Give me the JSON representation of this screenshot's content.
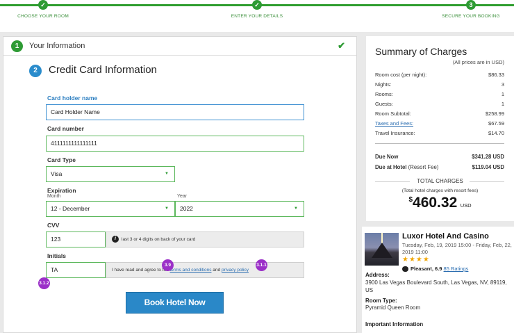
{
  "progress": {
    "steps": [
      {
        "number": "",
        "label": "CHOOSE YOUR ROOM"
      },
      {
        "number": "",
        "label": "ENTER YOUR DETAILS"
      },
      {
        "number": "3",
        "label": "SECURE YOUR BOOKING"
      }
    ]
  },
  "section1": {
    "number": "1",
    "title": "Your Information"
  },
  "section2": {
    "number": "2",
    "title": "Credit Card Information"
  },
  "form": {
    "card_holder_label": "Card holder name",
    "card_holder_value": "Card Holder Name",
    "card_number_label": "Card number",
    "card_number_value": "4111111111111111",
    "card_type_label": "Card Type",
    "card_type_value": "Visa",
    "expiration_label": "Expiration",
    "month_label": "Month",
    "month_value": "12 - December",
    "year_label": "Year",
    "year_value": "2022",
    "cvv_label": "CVV",
    "cvv_value": "123",
    "cvv_hint": "last 3 or 4 digits on back of your card",
    "initials_label": "Initials",
    "initials_value": "TA",
    "agree_prefix": "I have read and agree to the",
    "terms_link": "terms and conditions",
    "agree_and": "and",
    "privacy_link": "privacy policy",
    "book_button": "Book Hotel Now"
  },
  "annotations": {
    "a1": "3.9",
    "a2": "3.1.1",
    "a3": "3.1.2"
  },
  "summary": {
    "title": "Summary of Charges",
    "note": "(All prices are in USD)",
    "rows": [
      {
        "label": "Room cost (per night):",
        "value": "$86.33"
      },
      {
        "label": "Nights:",
        "value": "3"
      },
      {
        "label": "Rooms:",
        "value": "1"
      },
      {
        "label": "Guests:",
        "value": "1"
      },
      {
        "label": "Room Subtotal:",
        "value": "$258.99"
      },
      {
        "label": "Taxes and Fees:",
        "value": "$67.59"
      },
      {
        "label": "Travel Insurance:",
        "value": "$14.70"
      }
    ],
    "due_now_label": "Due Now",
    "due_now_value": "$341.28 USD",
    "due_hotel_label": "Due at Hotel",
    "due_hotel_sub": "(Resort Fee)",
    "due_hotel_value": "$119.04 USD",
    "total_header": "TOTAL CHARGES",
    "total_note": "(Total hotel charges with resort fees)",
    "total_currency": "$",
    "total_amount": "460.32",
    "total_unit": "USD"
  },
  "hotel": {
    "name": "Luxor Hotel And Casino",
    "dates": "Tuesday, Feb, 19, 2019 15:00 - Friday, Feb, 22, 2019 11:00",
    "stars": "★★★★",
    "rating_text": "Pleasant, 6.9",
    "ratings_link": "85 Ratings",
    "address_label": "Address:",
    "address": "3900 Las Vegas Boulevard South, Las Vegas, NV, 89119, US",
    "room_type_label": "Room Type:",
    "room_type": "Pyramid Queen Room",
    "important_label": "Important Information"
  },
  "colors": {
    "green": "#2e9b34",
    "blue": "#2a88c8",
    "annotation": "#9b30c8"
  }
}
